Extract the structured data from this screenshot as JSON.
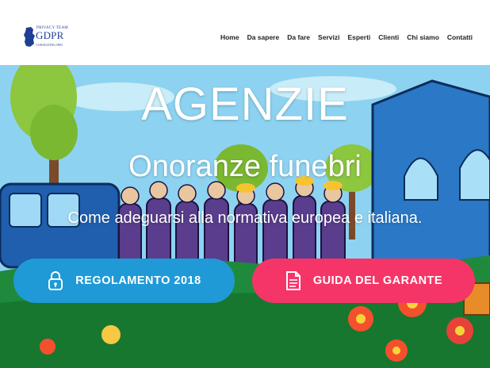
{
  "logo": {
    "top_text": "PRIVACY TEAM",
    "main_text": "GDPR",
    "bottom_text": "CONSULTING DPO"
  },
  "nav": {
    "items": [
      "Home",
      "Da sapere",
      "Da fare",
      "Servizi",
      "Esperti",
      "Clienti",
      "Chi siamo",
      "Contatti"
    ]
  },
  "hero": {
    "title": "AGENZIE",
    "subtitle": "Onoranze funebri",
    "tagline": "Come adeguarsi alla normativa europea e italiana."
  },
  "buttons": {
    "regolamento": "REGOLAMENTO 2018",
    "guida": "GUIDA DEL GARANTE"
  },
  "colors": {
    "blue": "#1f9ad6",
    "pink": "#f53568",
    "logo": "#1f3f96"
  },
  "icons": {
    "regolamento": "lock-icon",
    "guida": "document-icon"
  }
}
